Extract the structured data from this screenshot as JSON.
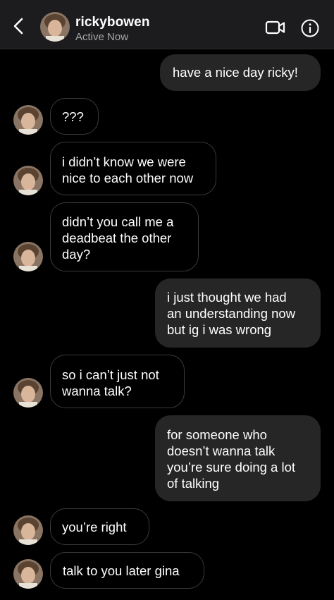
{
  "header": {
    "username": "rickybowen",
    "status": "Active Now",
    "back_icon": "chevron-left-icon",
    "video_icon": "video-camera-icon",
    "info_icon": "info-icon"
  },
  "messages": [
    {
      "side": "sent",
      "text": "have a nice day ricky!"
    },
    {
      "side": "received",
      "text": "???"
    },
    {
      "side": "received",
      "text": "i didn’t know we were\nnice to each other now"
    },
    {
      "side": "received",
      "text": "didn’t you call me a\ndeadbeat the other\nday?"
    },
    {
      "side": "sent",
      "text": "i just thought we had\nan understanding now\nbut ig i was wrong"
    },
    {
      "side": "received",
      "text": "so i can’t just not\nwanna talk?"
    },
    {
      "side": "sent",
      "text": "for someone who\ndoesn’t wanna talk\nyou’re sure doing a lot\nof talking"
    },
    {
      "side": "received",
      "text": "you’re right"
    },
    {
      "side": "received",
      "text": "talk to you later gina"
    }
  ],
  "colors": {
    "background": "#000000",
    "header_bg": "#1c1c1e",
    "sent_bubble": "#262626",
    "received_border": "#3a3a3a",
    "status_text": "#a8a8a8"
  }
}
